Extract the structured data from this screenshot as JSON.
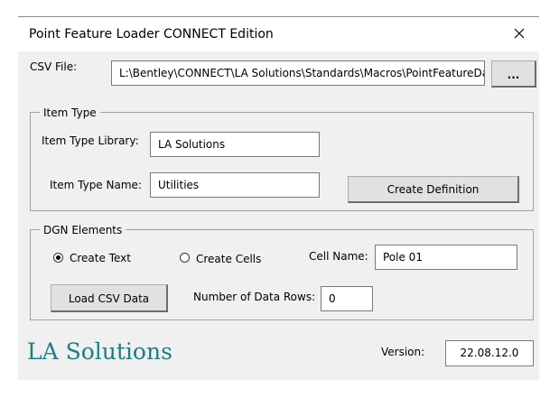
{
  "window": {
    "title": "Point Feature Loader CONNECT Edition"
  },
  "csv": {
    "label": "CSV File:",
    "path": "L:\\Bentley\\CONNECT\\LA Solutions\\Standards\\Macros\\PointFeatureData.",
    "browse_label": "..."
  },
  "item_type": {
    "group_label": "Item Type",
    "library_label": "Item Type Library:",
    "library_value": "LA Solutions",
    "name_label": "Item Type Name:",
    "name_value": "Utilities",
    "create_definition_label": "Create Definition"
  },
  "dgn": {
    "group_label": "DGN Elements",
    "create_text_label": "Create Text",
    "create_text_selected": true,
    "create_cells_label": "Create Cells",
    "create_cells_selected": false,
    "cell_name_label": "Cell Name:",
    "cell_name_value": "Pole 01",
    "load_csv_label": "Load CSV Data",
    "rows_label": "Number of Data Rows:",
    "rows_value": "0"
  },
  "footer": {
    "logo_text": "LA Solutions",
    "version_label": "Version:",
    "version_value": "22.08.12.0"
  },
  "colors": {
    "logo": "#1b7e85",
    "dialog_bg": "#f0f0f0"
  },
  "icons": {
    "close": "close-icon"
  }
}
